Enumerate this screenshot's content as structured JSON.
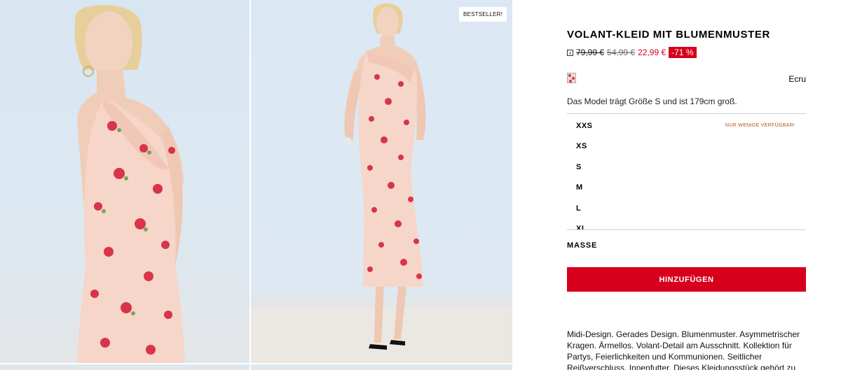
{
  "gallery": {
    "badge": "BESTSELLER!"
  },
  "product": {
    "title": "VOLANT-KLEID MIT BLUMENMUSTER",
    "price_original": "79,99 €",
    "price_previous": "54,99 €",
    "price_current": "22,99 €",
    "discount": "-71 %",
    "color": "Ecru",
    "model_info": "Das Model trägt Größe S und ist 179cm groß.",
    "sizes": [
      "XXS",
      "XS",
      "S",
      "M",
      "L",
      "XL"
    ],
    "availability_note": "NUR WENIGE VERFÜGBAR!",
    "measurements_label": "MASSE",
    "add_button": "HINZUFÜGEN",
    "description": "Midi-Design. Gerades Design. Blumenmuster. Asymmetrischer Kragen. Ärmellos. Volant-Detail am Ausschnitt. Kollektion für Partys, Feierlichkeiten und Kommunionen. Seitlicher Reißverschluss. Innenfutter. Dieses Kleidungsstück gehört zu unserer Event-Kollektion."
  },
  "colors": {
    "accent": "#d6001c",
    "availability": "#b5520f",
    "dress": "#f6d6c8",
    "flower": "#d8344a"
  },
  "icons": {
    "price_info": "info-icon",
    "color_swatch": "floral-swatch"
  }
}
